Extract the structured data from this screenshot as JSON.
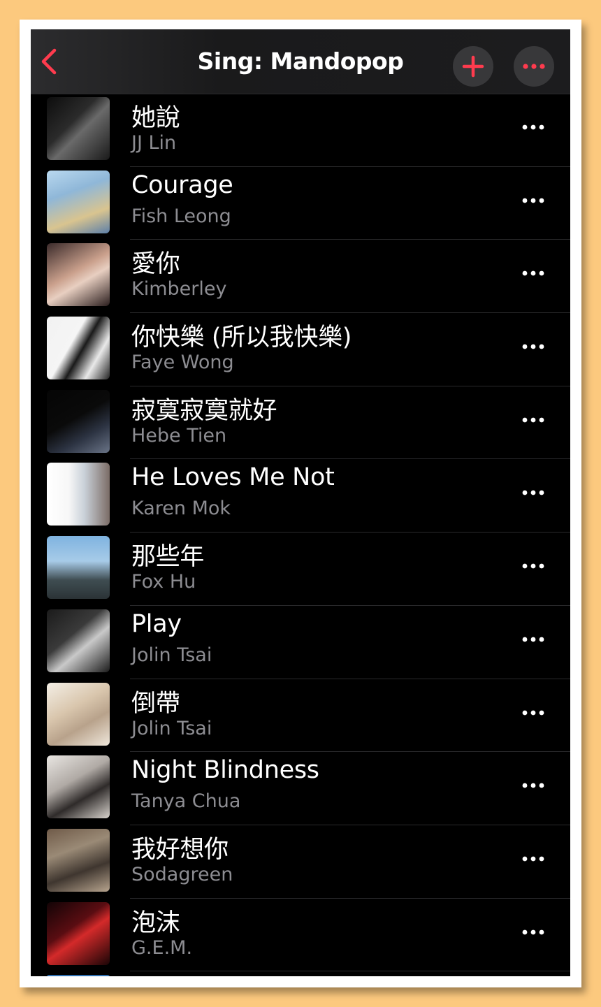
{
  "header": {
    "title": "Sing: Mandopop",
    "back_icon": "chevron-left-icon",
    "add_icon": "plus-icon",
    "more_icon": "ellipsis-icon",
    "accent_color": "#ff3b4e"
  },
  "songs": [
    {
      "title": "她說",
      "artist": "JJ Lin"
    },
    {
      "title": "Courage",
      "artist": "Fish Leong"
    },
    {
      "title": "愛你",
      "artist": "Kimberley"
    },
    {
      "title": "你快樂 (所以我快樂)",
      "artist": "Faye Wong"
    },
    {
      "title": "寂寞寂寞就好",
      "artist": "Hebe Tien"
    },
    {
      "title": "He Loves Me Not",
      "artist": "Karen Mok"
    },
    {
      "title": "那些年",
      "artist": "Fox Hu"
    },
    {
      "title": "Play",
      "artist": "Jolin Tsai"
    },
    {
      "title": "倒帶",
      "artist": "Jolin Tsai"
    },
    {
      "title": "Night Blindness",
      "artist": "Tanya Chua"
    },
    {
      "title": "我好想你",
      "artist": "Sodagreen"
    },
    {
      "title": "泡沫",
      "artist": "G.E.M."
    }
  ]
}
